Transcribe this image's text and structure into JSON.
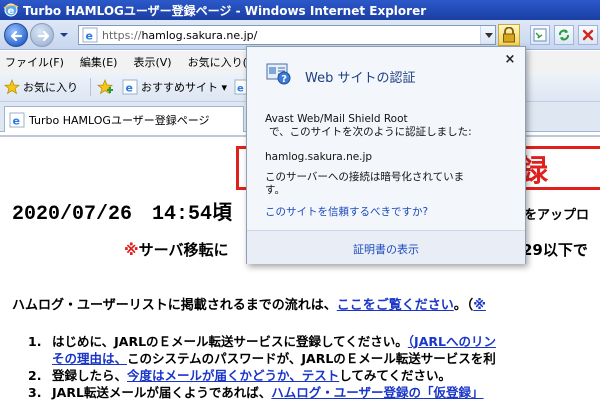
{
  "window": {
    "title": "Turbo HAMLOGユーザー登録ページ - Windows Internet Explorer"
  },
  "address_bar": {
    "url_protocol": "https://",
    "url_host": "hamlog.sakura.ne.jp/"
  },
  "menu": {
    "items": [
      {
        "label": "ファイル(F)"
      },
      {
        "label": "編集(E)"
      },
      {
        "label": "表示(V)"
      },
      {
        "label": "お気に入り(A)"
      }
    ]
  },
  "favorites_bar": {
    "favorites_label": "お気に入り",
    "suggested_label": "おすすめサイト ▾"
  },
  "tab": {
    "label": "Turbo HAMLOGユーザー登録ページ"
  },
  "page": {
    "title_fragment": "ー登録",
    "datetime": "2020/07/26　14:54頃",
    "datetime_right": "をアップロ",
    "server_note_mark": "※",
    "server_note_text": "サーバ移転に",
    "server_note_right": "29以下で",
    "list_prefix": "ハムログ・ユーザーリストに掲載されるまでの流れは、",
    "list_link": "ここをご覧ください",
    "list_suffix": "。（",
    "list_mark": "※",
    "steps": {
      "s1_num": "1.",
      "s1_text": "はじめに、JARLのＥメール転送サービスに登録してください。",
      "s1_link": "（JARLへのリン",
      "s1b_link": "その理由は、",
      "s1b_text": "このシステムのパスワードが、JARLのＥメール転送サービスを利",
      "s2_num": "2.",
      "s2_text": "登録したら、",
      "s2_link": "今度はメールが届くかどうか、テスト",
      "s2_suffix": "してみてください。",
      "s3_num": "3.",
      "s3_text": "JARL転送メールが届くようであれば、",
      "s3_link": "ハムログ・ユーザー登録の「仮登録」"
    }
  },
  "dialog": {
    "title": "Web サイトの認証",
    "close": "×",
    "issuer": "Avast Web/Mail Shield Root",
    "issuer_note": "で、このサイトを次のように認証しました:",
    "host": "hamlog.sakura.ne.jp",
    "encrypted_1": "このサーバーへの接続は暗号化されていま",
    "encrypted_2": "す。",
    "trust_link": "このサイトを信頼するべきですか?",
    "cert_link": "証明書の表示"
  },
  "colors": {
    "accent_red": "#e0201c",
    "link_blue": "#1a36c8",
    "titlebar_blue": "#1a3fa5"
  }
}
